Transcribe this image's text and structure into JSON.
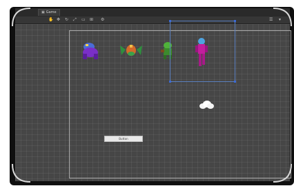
{
  "window": {
    "tab_label": "Game",
    "tab_icon": "game-view-icon"
  },
  "toolbar": {
    "icons": [
      "hand-tool-icon",
      "move-tool-icon",
      "rotate-tool-icon",
      "scale-tool-icon",
      "rect-tool-icon",
      "transform-tool-icon",
      "custom-tool-icon"
    ],
    "right_icons": [
      "layers-icon",
      "layout-icon"
    ]
  },
  "scene": {
    "characters": [
      {
        "name": "purple-beast",
        "color": "#7a2fc8"
      },
      {
        "name": "green-winged-creature",
        "color": "#3aa24a"
      },
      {
        "name": "green-goblin",
        "color": "#4fb23a"
      },
      {
        "name": "pink-dancer",
        "color": "#c21e9c"
      }
    ],
    "button_label": "Button",
    "selection_color": "#3c6bd6",
    "grid_color": "#464646"
  }
}
